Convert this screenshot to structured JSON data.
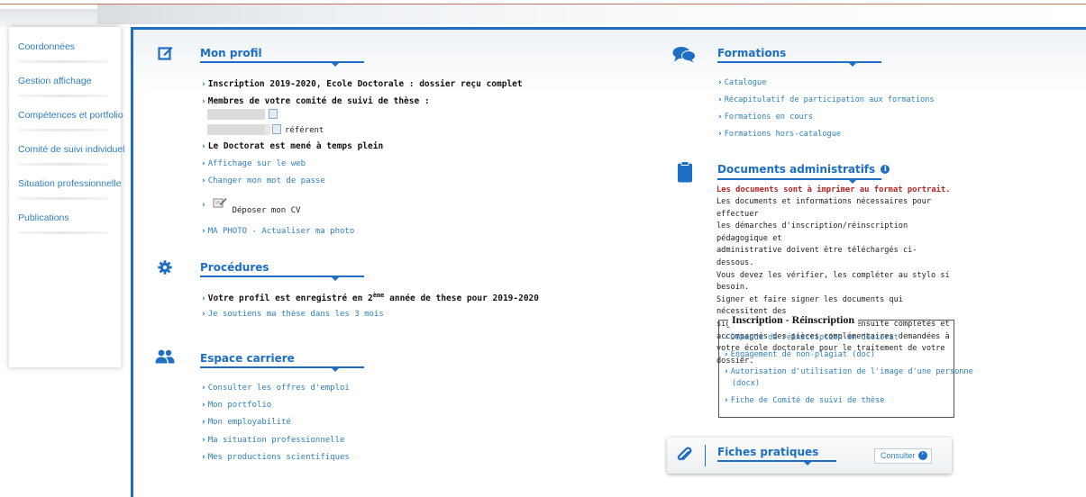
{
  "sidebar": {
    "items": [
      {
        "label": "Coordonnées"
      },
      {
        "label": "Gestion affichage"
      },
      {
        "label": "Compétences et portfolio"
      },
      {
        "label": "Comité de suivi individuel"
      },
      {
        "label": "Situation professionnelle"
      },
      {
        "label": "Publications"
      }
    ]
  },
  "profil": {
    "title": "Mon profil",
    "inscription": "Inscription 2019-2020, Ecole Doctorale : dossier reçu complet",
    "membres": "Membres de votre comité de suivi de thèse :",
    "referent": "référent",
    "temps_plein": "Le Doctorat est mené à temps plein",
    "affichage_web": "Affichage sur le web",
    "changer_mdp": "Changer mon mot de passe",
    "deposer_cv": "Déposer mon CV",
    "ma_photo": "MA PHOTO - Actualiser ma photo"
  },
  "procedures": {
    "title": "Procédures",
    "line1_pre": "Votre profil est enregistré en 2",
    "line1_sup": "ème",
    "line1_post": " année de these pour 2019-2020",
    "soutiens": "Je soutiens ma thèse dans les 3 mois"
  },
  "carriere": {
    "title": "Espace carriere",
    "links": [
      {
        "label": "Consulter les offres d'emploi"
      },
      {
        "label": "Mon portfolio"
      },
      {
        "label": "Mon employabilité"
      },
      {
        "label": "Ma situation professionnelle"
      },
      {
        "label": "Mes productions scientifiques"
      }
    ]
  },
  "formations": {
    "title": "Formations",
    "links": [
      {
        "label": "Catalogue"
      },
      {
        "label": "Récapitulatif de participation aux formations"
      },
      {
        "label": "Formations en cours"
      },
      {
        "label": "Formations hors-catalogue"
      }
    ]
  },
  "documents": {
    "title": "Documents administratifs",
    "warning": "Les documents sont à imprimer au format portrait.",
    "lines": [
      "Les documents et informations nécessaires pour effectuer",
      "les démarches d'inscription/réinscription pédagogique et",
      "administrative doivent être téléchargés ci-dessous.",
      "Vous devez les vérifier, les compléter au stylo si besoin.",
      "Signer et faire signer les documents qui nécessitent des",
      "signatures et les transmettre ensuite complétés et",
      "accompagnés des pièces complémentaires demandées à",
      "votre école doctorale pour le traitement de votre dossier."
    ]
  },
  "inscription": {
    "title": "Inscription - Réinscription",
    "links": [
      {
        "label": "Demande de réinscription en doctorat"
      },
      {
        "label": "Engagement de non-plagiat (doc)"
      },
      {
        "label": "Autorisation d'utilisation de l'image d'une personne"
      },
      {
        "label": "(docx)"
      },
      {
        "label": "Fiche de Comité de suivi de thèse"
      }
    ]
  },
  "fiches": {
    "title": "Fiches pratiques",
    "button": "Consulter"
  },
  "colors": {
    "accent": "#1d6ec4",
    "link": "#2e7fc0",
    "warning": "#b22222"
  }
}
